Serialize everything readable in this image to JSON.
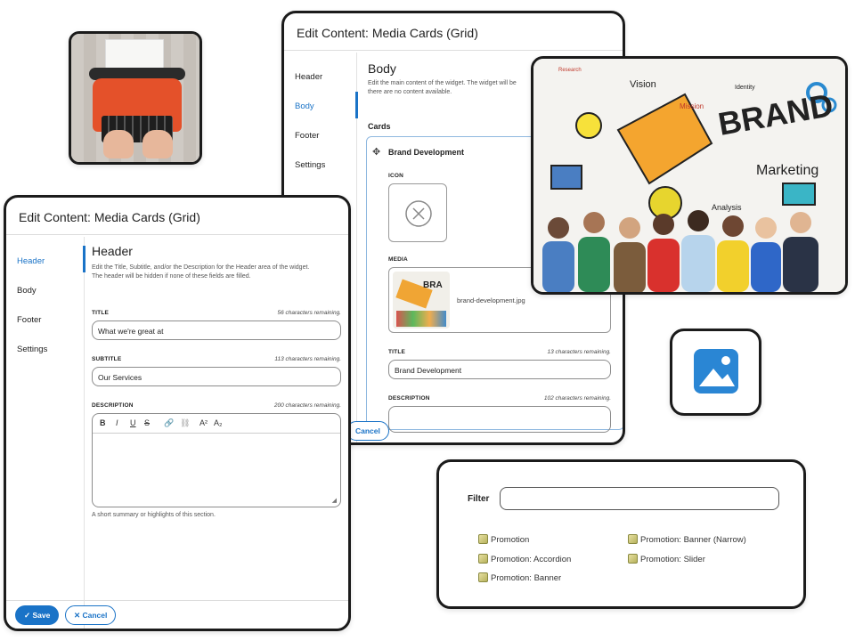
{
  "back_panel": {
    "title": "Edit Content: Media Cards (Grid)",
    "nav": [
      "Header",
      "Body",
      "Footer",
      "Settings"
    ],
    "section_title": "Body",
    "help_line1": "Edit the main content of the widget. The widget will be",
    "help_line2": "there are no content available.",
    "cards_label": "Cards",
    "card_name": "Brand Development",
    "icon_label": "ICON",
    "media_label": "MEDIA",
    "media_filename": "brand-development.jpg",
    "title_label": "TITLE",
    "title_count": "13 characters remaining.",
    "title_value": "Brand Development",
    "description_label": "DESCRIPTION",
    "description_count": "102 characters remaining.",
    "cancel_label": "Cancel"
  },
  "front_panel": {
    "title": "Edit Content: Media Cards (Grid)",
    "nav": [
      "Header",
      "Body",
      "Footer",
      "Settings"
    ],
    "section_title": "Header",
    "help_line1": "Edit the Title, Subtitle, and/or the Description for the Header area of the widget.",
    "help_line2": "The header will be hidden if none of these fields are filled.",
    "title_label": "TITLE",
    "title_count": "56 characters remaining.",
    "title_value": "What we're great at",
    "subtitle_label": "SUBTITLE",
    "subtitle_count": "113 characters remaining.",
    "subtitle_value": "Our Services",
    "description_label": "DESCRIPTION",
    "description_count": "200 characters remaining.",
    "toolbar": [
      "B",
      "I",
      "U",
      "S",
      "link",
      "unlink",
      "A²",
      "A₂"
    ],
    "description_hint": "A short summary or highlights of this section.",
    "save_label": "Save",
    "cancel_label": "Cancel"
  },
  "brand_image": {
    "words": [
      "BRAND",
      "Marketing",
      "Vision",
      "Mission",
      "Identity",
      "Analysis",
      "Research"
    ]
  },
  "filter_panel": {
    "label": "Filter",
    "input_value": "",
    "items": [
      "Promotion",
      "Promotion: Accordion",
      "Promotion: Banner",
      "Promotion: Banner (Narrow)",
      "Promotion: Slider"
    ]
  },
  "colors": {
    "accent": "#1a73c7",
    "frame": "#1b1b1b"
  }
}
